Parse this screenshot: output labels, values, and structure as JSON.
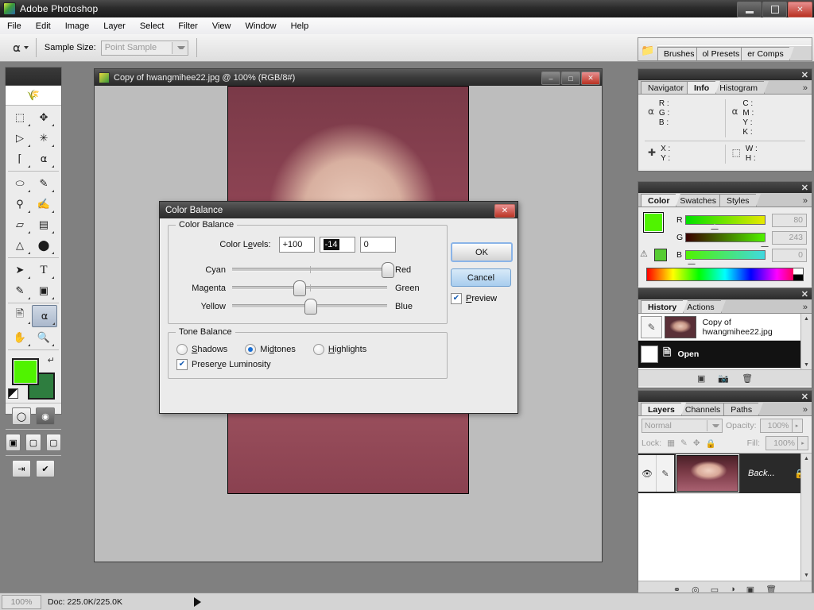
{
  "window": {
    "title": "Adobe Photoshop",
    "app_icon": "photoshop-icon",
    "minimize": "–",
    "restore": "❐",
    "close": "✕"
  },
  "menubar": {
    "items": [
      {
        "label": "File"
      },
      {
        "label": "Edit"
      },
      {
        "label": "Image"
      },
      {
        "label": "Layer"
      },
      {
        "label": "Select"
      },
      {
        "label": "Filter"
      },
      {
        "label": "View"
      },
      {
        "label": "Window"
      },
      {
        "label": "Help"
      }
    ]
  },
  "options_bar": {
    "tool_icon": "eyedropper-icon",
    "tool_preset_arrow": "▾",
    "sample_size_label": "Sample Size:",
    "sample_size_value": "Point Sample",
    "combo_arrow": "▾"
  },
  "palette_well": {
    "folder_icon": "folder-icon",
    "tabs": [
      {
        "label": "Brushes"
      },
      {
        "label": "ol Presets"
      },
      {
        "label": "er Comps"
      }
    ]
  },
  "toolbox": {
    "feather_icon": "feather-logo-icon",
    "tools": [
      {
        "name": "marquee-tool",
        "glyph": "⬚"
      },
      {
        "name": "move-tool",
        "glyph": "✥"
      },
      {
        "name": "lasso-tool",
        "glyph": "⌇"
      },
      {
        "name": "magic-wand-tool",
        "glyph": "✳"
      },
      {
        "name": "crop-tool",
        "glyph": "⌗"
      },
      {
        "name": "slice-tool",
        "glyph": "✂"
      },
      {
        "name": "healing-brush-tool",
        "glyph": "⬭"
      },
      {
        "name": "brush-tool",
        "glyph": "✎"
      },
      {
        "name": "clone-stamp-tool",
        "glyph": "⚲"
      },
      {
        "name": "history-brush-tool",
        "glyph": "✐"
      },
      {
        "name": "eraser-tool",
        "glyph": "▱"
      },
      {
        "name": "gradient-tool",
        "glyph": "▤"
      },
      {
        "name": "blur-tool",
        "glyph": "△"
      },
      {
        "name": "dodge-tool",
        "glyph": "⬤"
      },
      {
        "name": "path-selection-tool",
        "glyph": "➤"
      },
      {
        "name": "type-tool",
        "glyph": "T"
      },
      {
        "name": "pen-tool",
        "glyph": "✒"
      },
      {
        "name": "shape-tool",
        "glyph": "▣"
      },
      {
        "name": "notes-tool",
        "glyph": "🗒"
      },
      {
        "name": "eyedropper-tool",
        "glyph": "⚲",
        "selected": true
      },
      {
        "name": "hand-tool",
        "glyph": "✋"
      },
      {
        "name": "zoom-tool",
        "glyph": "🔍"
      }
    ],
    "foreground_color": "#50f300",
    "background_color": "#2e7d3f",
    "swap_icon": "↰",
    "default_colors_icon": "default-colors-icon",
    "mode_buttons": [
      {
        "name": "standard-mask-mode",
        "glyph": "◯"
      },
      {
        "name": "quick-mask-mode",
        "glyph": "◑"
      }
    ],
    "screen_buttons": [
      {
        "name": "standard-screen-mode",
        "glyph": "▣"
      },
      {
        "name": "full-screen-menubar-mode",
        "glyph": "▢"
      },
      {
        "name": "full-screen-mode",
        "glyph": "▢"
      }
    ],
    "jump_buttons": [
      {
        "name": "jump-to-imageready",
        "glyph": "⇥"
      },
      {
        "name": "check-tool",
        "glyph": "✔"
      }
    ]
  },
  "document": {
    "title": "Copy of hwangmihee22.jpg @ 100% (RGB/8#)",
    "icon": "document-icon",
    "minimize": "–",
    "restore": "❐",
    "close": "✕"
  },
  "info_panel": {
    "tabs": [
      {
        "label": "Navigator",
        "active": false
      },
      {
        "label": "Info",
        "active": true
      },
      {
        "label": "Histogram",
        "active": false
      }
    ],
    "more_icon": "»",
    "close_icon": "✕",
    "left_eyedropper": "eyedropper-icon",
    "right_eyedropper": "eyedropper-icon",
    "rgb_rows": [
      "R :",
      "G :",
      "B :"
    ],
    "cmyk_rows": [
      "C :",
      "M :",
      "Y :",
      "K :"
    ],
    "pos_icon": "crosshair-icon",
    "pos_rows": [
      "X :",
      "Y :"
    ],
    "size_icon": "marquee-icon",
    "size_rows": [
      "W :",
      "H :"
    ]
  },
  "color_panel": {
    "tabs": [
      {
        "label": "Color",
        "active": true
      },
      {
        "label": "Swatches",
        "active": false
      },
      {
        "label": "Styles",
        "active": false
      }
    ],
    "more_icon": "»",
    "close_icon": "✕",
    "warning_icon": "gamut-warning-icon",
    "foreground_color": "#50f300",
    "background_color": "#2e7d3f",
    "warning_swatch": "#57cc33",
    "channels": [
      {
        "label": "R",
        "value": "80",
        "pos_pct": 31
      },
      {
        "label": "G",
        "value": "243",
        "pos_pct": 95
      },
      {
        "label": "B",
        "value": "0",
        "pos_pct": 2
      }
    ]
  },
  "history_panel": {
    "tabs": [
      {
        "label": "History",
        "active": true
      },
      {
        "label": "Actions",
        "active": false
      }
    ],
    "more_icon": "»",
    "close_icon": "✕",
    "rows": [
      {
        "label": "Copy of hwangmihee22.jpg",
        "icon": "snapshot-icon",
        "selected": false
      },
      {
        "label": "Open",
        "icon": "open-state-icon",
        "selected": true
      }
    ],
    "scroll_up": "▲",
    "scroll_down": "▼",
    "footer_buttons": [
      {
        "name": "new-document-from-state-button",
        "glyph": "▣"
      },
      {
        "name": "new-snapshot-button",
        "glyph": "📷"
      },
      {
        "name": "delete-state-button",
        "glyph": "🗑"
      }
    ]
  },
  "layers_panel": {
    "tabs": [
      {
        "label": "Layers",
        "active": true
      },
      {
        "label": "Channels",
        "active": false
      },
      {
        "label": "Paths",
        "active": false
      }
    ],
    "more_icon": "»",
    "close_icon": "✕",
    "blend_mode": "Normal",
    "blend_arrow": "▾",
    "opacity_label": "Opacity:",
    "opacity_value": "100%",
    "opacity_arrow": "▸",
    "lock_label": "Lock:",
    "lock_icons": [
      {
        "name": "lock-transparency-icon",
        "glyph": "▩"
      },
      {
        "name": "lock-image-icon",
        "glyph": "✎"
      },
      {
        "name": "lock-position-icon",
        "glyph": "✥"
      },
      {
        "name": "lock-all-icon",
        "glyph": "🔒"
      }
    ],
    "fill_label": "Fill:",
    "fill_value": "100%",
    "fill_arrow": "▸",
    "layers": [
      {
        "name": "Back...",
        "visible_icon": "eye-icon",
        "brush_icon": "brush-icon",
        "lock_icon": "lock-icon",
        "selected": true
      }
    ],
    "scroll_up": "▲",
    "scroll_down": "▼",
    "footer_buttons": [
      {
        "name": "layer-style-button",
        "glyph": "◍"
      },
      {
        "name": "layer-mask-button",
        "glyph": "◎"
      },
      {
        "name": "new-group-button",
        "glyph": "▭"
      },
      {
        "name": "new-adjustment-layer-button",
        "glyph": "◑"
      },
      {
        "name": "new-layer-button",
        "glyph": "▣"
      },
      {
        "name": "delete-layer-button",
        "glyph": "🗑"
      }
    ]
  },
  "status_bar": {
    "zoom": "100%",
    "doc_info": "Doc: 225.0K/225.0K",
    "expand_arrow": "▶"
  },
  "dialog": {
    "title": "Color Balance",
    "close_icon": "✕",
    "color_balance_group": {
      "legend": "Color Balance",
      "levels_label_pre": "Color L",
      "levels_label_underline": "e",
      "levels_label_post": "vels:",
      "levels": [
        {
          "name": "cyan-red-level",
          "value": "+100",
          "selected": false
        },
        {
          "name": "magenta-green-level",
          "value": "-14",
          "selected": true
        },
        {
          "name": "yellow-blue-level",
          "value": "0",
          "selected": false
        }
      ],
      "sliders": [
        {
          "name": "cyan-red-slider",
          "left_label": "Cyan",
          "right_label": "Red",
          "value": 100,
          "pos_pct": 100
        },
        {
          "name": "magenta-green-slider",
          "left_label": "Magenta",
          "right_label": "Green",
          "value": -14,
          "pos_pct": 43
        },
        {
          "name": "yellow-blue-slider",
          "left_label": "Yellow",
          "right_label": "Blue",
          "value": 0,
          "pos_pct": 50
        }
      ]
    },
    "tone_balance_group": {
      "legend": "Tone Balance",
      "options": [
        {
          "name": "shadows-radio",
          "label_pre": "",
          "label_u": "S",
          "label_post": "hadows",
          "selected": false
        },
        {
          "name": "midtones-radio",
          "label_pre": "Mi",
          "label_u": "d",
          "label_post": "tones",
          "selected": true
        },
        {
          "name": "highlights-radio",
          "label_pre": "",
          "label_u": "H",
          "label_post": "ighlights",
          "selected": false
        }
      ],
      "preserve_luminosity": {
        "label_pre": "Preser",
        "label_u": "v",
        "label_post": "e Luminosity",
        "checked": true,
        "check_glyph": "✔"
      }
    },
    "buttons": {
      "ok": "OK",
      "cancel": "Cancel"
    },
    "preview": {
      "label_pre": "",
      "label_u": "P",
      "label_post": "review",
      "checked": true,
      "check_glyph": "✔"
    }
  }
}
